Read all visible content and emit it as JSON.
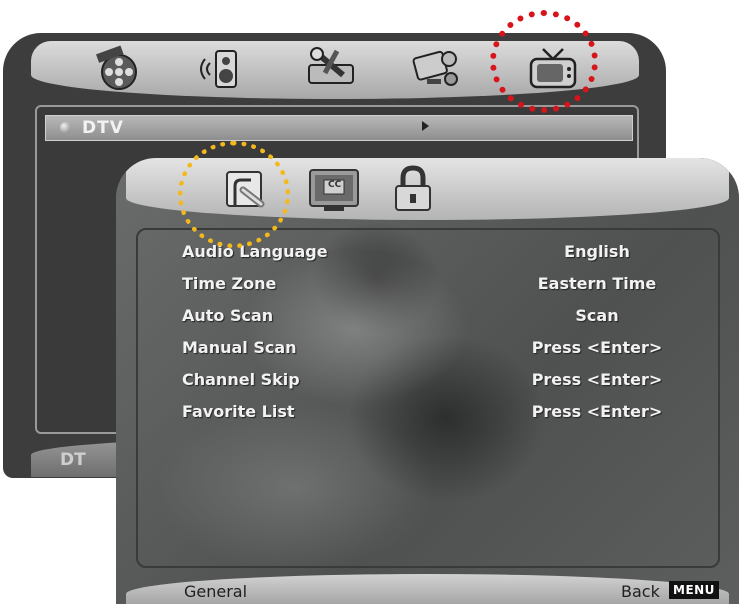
{
  "back_menu": {
    "tabs": [
      {
        "name": "film-reel-icon"
      },
      {
        "name": "speaker-icon"
      },
      {
        "name": "tools-icon"
      },
      {
        "name": "monitor-settings-icon"
      },
      {
        "name": "tv-icon"
      }
    ],
    "selected_item": "DTV",
    "bottom_text": "DT"
  },
  "front_menu": {
    "tabs": [
      {
        "name": "general-settings-icon"
      },
      {
        "name": "closed-caption-icon",
        "label": "CC"
      },
      {
        "name": "lock-icon"
      }
    ],
    "settings": [
      {
        "label": "Audio Language",
        "value": "English"
      },
      {
        "label": "Time Zone",
        "value": "Eastern Time"
      },
      {
        "label": "Auto Scan",
        "value": "Scan"
      },
      {
        "label": "Manual Scan",
        "value": "Press <Enter>"
      },
      {
        "label": "Channel Skip",
        "value": "Press <Enter>"
      },
      {
        "label": "Favorite List",
        "value": "Press <Enter>"
      }
    ],
    "footer": {
      "section": "General",
      "back": "Back",
      "menu_key": "MENU"
    }
  },
  "colors": {
    "highlight_red": "#d8141b",
    "highlight_yellow": "#f3b91c"
  }
}
